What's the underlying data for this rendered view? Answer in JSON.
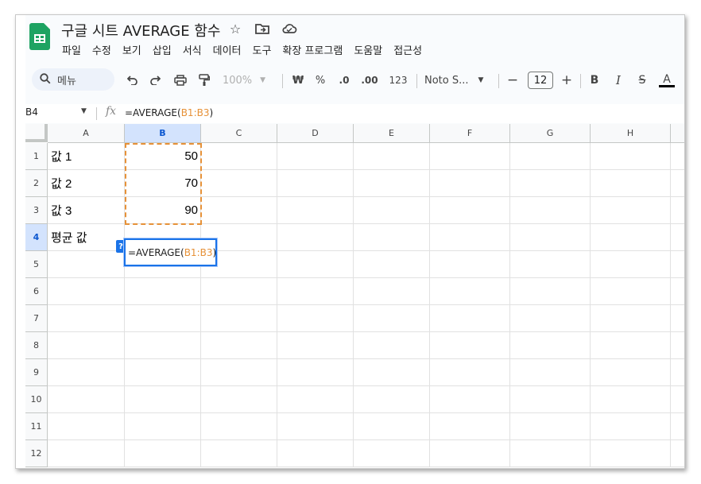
{
  "app": {
    "doc_title": "구글 시트 AVERAGE 함수",
    "brand_color": "#1ea362",
    "title_icons": [
      "star-icon",
      "move-to-folder-icon",
      "cloud-status-icon"
    ]
  },
  "menu": {
    "items": [
      "파일",
      "수정",
      "보기",
      "삽입",
      "서식",
      "데이터",
      "도구",
      "확장 프로그램",
      "도움말",
      "접근성"
    ]
  },
  "toolbar": {
    "search_label": "메뉴",
    "zoom": "100%",
    "currency": "₩",
    "percent": "%",
    "dec_decrease": ".0",
    "dec_increase": ".00",
    "number_format": "123",
    "font_name": "Noto S...",
    "font_size": "12",
    "minus": "−",
    "plus": "+",
    "bold": "B",
    "italic": "I",
    "strike": "S",
    "text_color": "A"
  },
  "formula_bar": {
    "cell_ref": "B4",
    "formula_prefix": "=AVERAGE(",
    "formula_range": "B1:B3",
    "formula_suffix": ")"
  },
  "sheet": {
    "columns": [
      "A",
      "B",
      "C",
      "D",
      "E",
      "F",
      "G",
      "H"
    ],
    "rows": [
      "1",
      "2",
      "3",
      "4",
      "5",
      "6",
      "7",
      "8",
      "9",
      "10",
      "11",
      "12"
    ],
    "cells": {
      "A1": "값 1",
      "B1": "50",
      "A2": "값 2",
      "B2": "70",
      "A3": "값 3",
      "B3": "90",
      "A4": "평균 값"
    },
    "editing_cell": {
      "prefix": "=AVERAGE(",
      "range": "B1:B3",
      "suffix": ")",
      "help_badge": "?"
    },
    "selected_column": "B",
    "selected_row": "4",
    "range_color": "#e69138",
    "selection_color": "#1a73e8"
  }
}
